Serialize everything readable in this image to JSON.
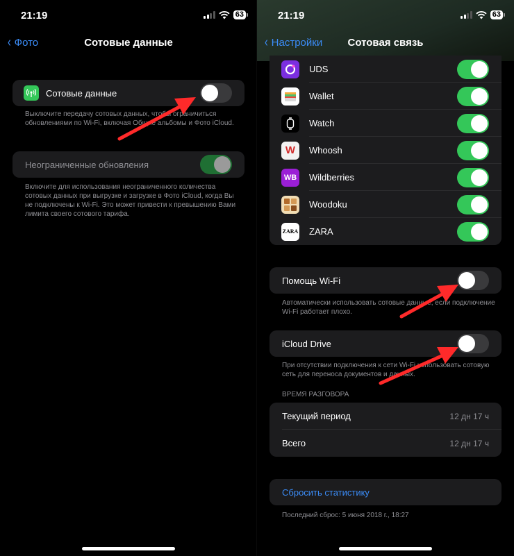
{
  "status": {
    "time": "21:19",
    "battery": "63"
  },
  "left": {
    "nav": {
      "back_label": "Фото",
      "title": "Сотовые данные"
    },
    "cellular_row": {
      "label": "Сотовые данные",
      "icon": "antenna-icon",
      "toggle": "off"
    },
    "cellular_footer": "Выключите передачу сотовых данных, чтобы ограничиться обновлениями по Wi-Fi, включая Общие альбомы и Фото iCloud.",
    "unlimited_row": {
      "label": "Неограниченные обновления",
      "toggle": "on-disabled"
    },
    "unlimited_footer": "Включите для использования неограниченного количества сотовых данных при выгрузке и загрузке в Фото iCloud, когда Вы не подключены к Wi-Fi. Это может привести к превышению Вами лимита своего сотового тарифа."
  },
  "right": {
    "nav": {
      "back_label": "Настройки",
      "title": "Сотовая связь"
    },
    "apps": [
      {
        "name": "UDS",
        "icon": "uds-icon",
        "icon_text": "",
        "toggle": "on"
      },
      {
        "name": "Wallet",
        "icon": "wallet-icon",
        "icon_text": "",
        "toggle": "on"
      },
      {
        "name": "Watch",
        "icon": "watch-icon",
        "icon_text": "",
        "toggle": "on"
      },
      {
        "name": "Whoosh",
        "icon": "whoosh-icon",
        "icon_text": "W",
        "toggle": "on"
      },
      {
        "name": "Wildberries",
        "icon": "wildberries-icon",
        "icon_text": "WB",
        "toggle": "on"
      },
      {
        "name": "Woodoku",
        "icon": "woodoku-icon",
        "icon_text": "",
        "toggle": "on"
      },
      {
        "name": "ZARA",
        "icon": "zara-icon",
        "icon_text": "ZARA",
        "toggle": "on"
      }
    ],
    "wifi_assist": {
      "label": "Помощь Wi-Fi",
      "toggle": "off"
    },
    "wifi_assist_footer": "Автоматически использовать сотовые данные, если подключение Wi-Fi работает плохо.",
    "icloud_drive": {
      "label": "iCloud Drive",
      "toggle": "off"
    },
    "icloud_drive_footer": "При отсутствии подключения к сети Wi-Fi использовать сотовую сеть для переноса документов и данных.",
    "call_time": {
      "header": "ВРЕМЯ РАЗГОВОРА",
      "rows": [
        {
          "label": "Текущий период",
          "value": "12 дн 17 ч"
        },
        {
          "label": "Всего",
          "value": "12 дн 17 ч"
        }
      ]
    },
    "reset_label": "Сбросить статистику",
    "last_reset": "Последний сброс: 5 июня 2018 г., 18:27"
  },
  "colors": {
    "accent": "#3b8cf7",
    "toggle_on": "#34c759",
    "annotation_arrow": "#ff2a2a",
    "cell_bg": "#1c1c1e"
  }
}
